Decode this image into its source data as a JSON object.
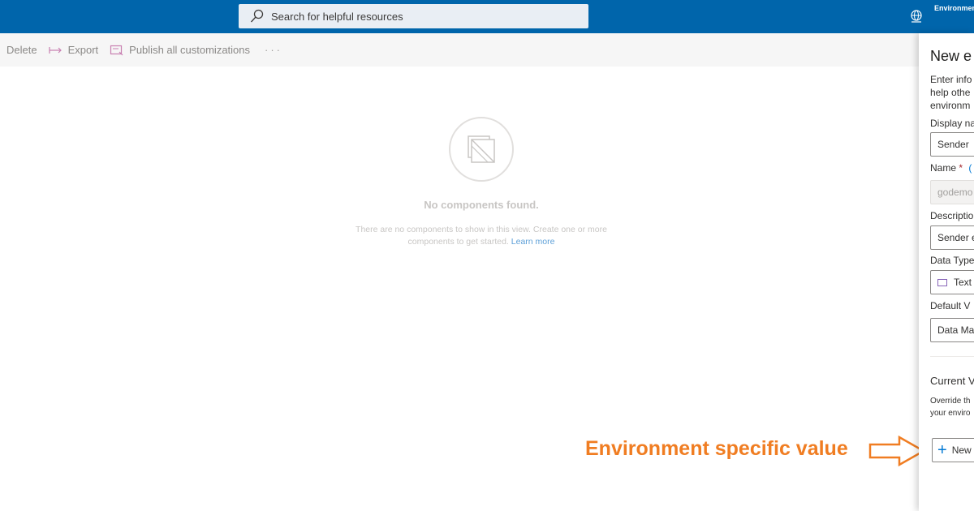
{
  "header": {
    "search_placeholder": "Search for helpful resources",
    "environment_label": "Environmen"
  },
  "commands": {
    "delete": "Delete",
    "export": "Export",
    "publish": "Publish all customizations",
    "more": "···"
  },
  "empty_state": {
    "title": "No components found.",
    "description": "There are no components to show in this view. Create one or more components to get started.",
    "learn_more": "Learn more"
  },
  "annotation": {
    "text": "Environment specific value"
  },
  "panel": {
    "title": "New e",
    "intro": "Enter info\nhelp othe\nenvironm",
    "display_name_label": "Display na",
    "display_name_value": "Sender",
    "name_label": "Name",
    "name_required": "*",
    "name_info": "(",
    "name_value": "godemo",
    "description_label": "Descriptio",
    "description_value": "Sender e",
    "data_type_label": "Data Type",
    "data_type_value": "Text",
    "default_value_label": "Default V",
    "default_value_value": "Data Ma",
    "current_value_heading": "Current V",
    "override_text": "Override th\nyour enviro",
    "new_value_button": "New"
  },
  "colors": {
    "topbar": "#0065ab",
    "annotation": "#f07d22",
    "link": "#5ea0d8"
  }
}
